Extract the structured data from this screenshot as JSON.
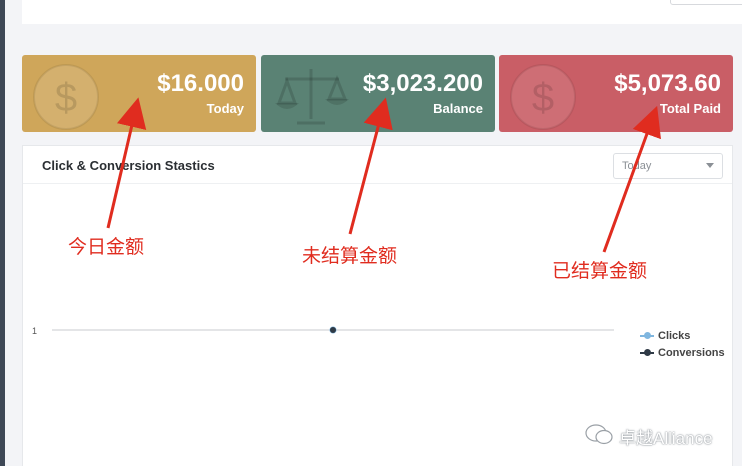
{
  "cards": [
    {
      "amount": "$16.000",
      "label": "Today",
      "color": "#cfa65a",
      "icon": "dollar-coin-icon"
    },
    {
      "amount": "$3,023.200",
      "label": "Balance",
      "color": "#5a8274",
      "icon": "scales-icon"
    },
    {
      "amount": "$5,073.60",
      "label": "Total Paid",
      "color": "#c95e66",
      "icon": "dollar-coin-icon"
    }
  ],
  "panel": {
    "title": "Click & Conversion Stastics",
    "period": "Today"
  },
  "chart_data": {
    "type": "line",
    "y_tick_labels": [
      "1"
    ],
    "series": [
      {
        "name": "Clicks",
        "color": "#7fb6df",
        "values": [
          1
        ]
      },
      {
        "name": "Conversions",
        "color": "#2f3a46",
        "values": [
          1
        ]
      }
    ]
  },
  "annotations": {
    "today": "今日金额",
    "unsettled": "未结算金额",
    "settled": "已结算金额"
  },
  "watermark": "卓越Alliance"
}
